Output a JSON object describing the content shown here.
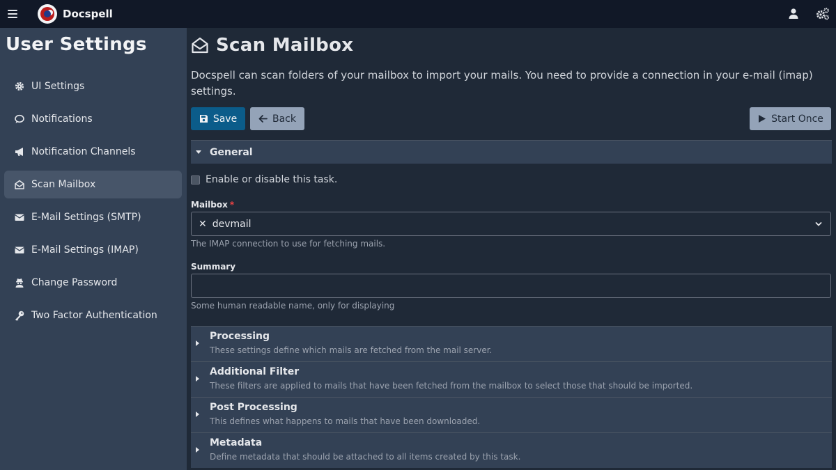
{
  "app": {
    "brand": "Docspell"
  },
  "colors": {
    "topbar": "#111827",
    "sidebar": "#334155",
    "main": "#1f2937",
    "primary": "#0b5c8a",
    "secondary": "#94a3b8",
    "required": "#ef4444"
  },
  "sidebar": {
    "title": "User Settings",
    "items": [
      {
        "label": "UI Settings",
        "icon": "gear-icon"
      },
      {
        "label": "Notifications",
        "icon": "comment-icon"
      },
      {
        "label": "Notification Channels",
        "icon": "bullhorn-icon"
      },
      {
        "label": "Scan Mailbox",
        "icon": "envelope-open-icon",
        "active": true
      },
      {
        "label": "E-Mail Settings (SMTP)",
        "icon": "envelope-icon"
      },
      {
        "label": "E-Mail Settings (IMAP)",
        "icon": "envelope-icon"
      },
      {
        "label": "Change Password",
        "icon": "user-secret-icon"
      },
      {
        "label": "Two Factor Authentication",
        "icon": "key-icon"
      }
    ]
  },
  "main": {
    "title": "Scan Mailbox",
    "description": "Docspell can scan folders of your mailbox to import your mails. You need to provide a connection in your e-mail (imap) settings.",
    "buttons": {
      "save": "Save",
      "back": "Back",
      "start_once": "Start Once"
    },
    "general": {
      "title": "General",
      "enable_label": "Enable or disable this task.",
      "mailbox": {
        "label": "Mailbox",
        "required_mark": "*",
        "value": "devmail",
        "help": "The IMAP connection to use for fetching mails."
      },
      "summary": {
        "label": "Summary",
        "value": "",
        "placeholder": "",
        "help": "Some human readable name, only for displaying"
      }
    },
    "sections": [
      {
        "title": "Processing",
        "subtitle": "These settings define which mails are fetched from the mail server."
      },
      {
        "title": "Additional Filter",
        "subtitle": "These filters are applied to mails that have been fetched from the mailbox to select those that should be imported."
      },
      {
        "title": "Post Processing",
        "subtitle": "This defines what happens to mails that have been downloaded."
      },
      {
        "title": "Metadata",
        "subtitle": "Define metadata that should be attached to all items created by this task."
      }
    ]
  }
}
